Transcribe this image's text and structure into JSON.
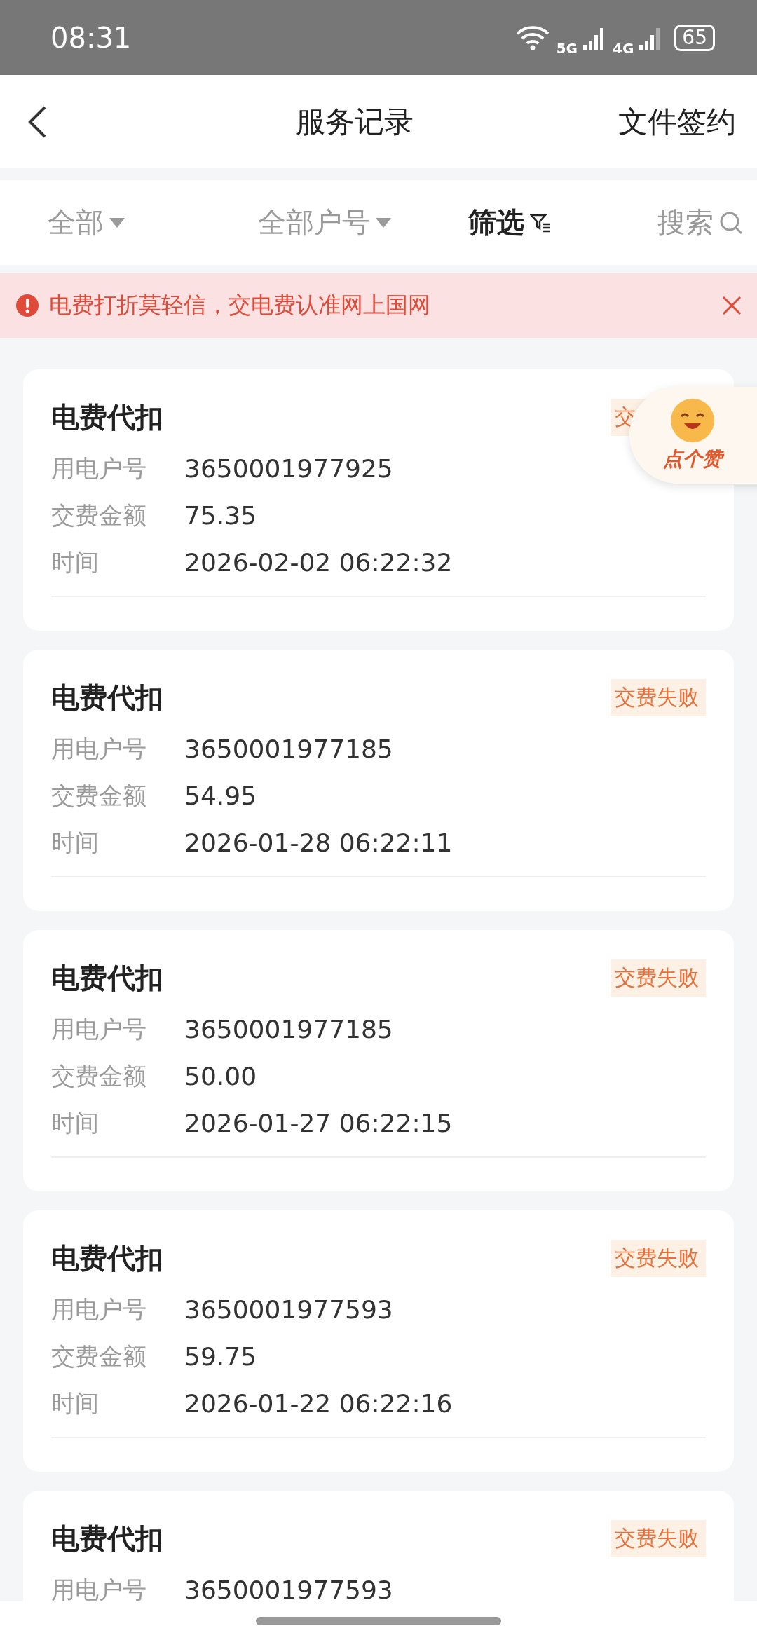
{
  "status_bar": {
    "time": "08:31",
    "network_1": "5G",
    "network_2": "4G",
    "battery": "65"
  },
  "header": {
    "title": "服务记录",
    "action": "文件签约"
  },
  "filters": [
    {
      "label": "全部",
      "kind": "dropdown",
      "selected": false
    },
    {
      "label": "全部户号",
      "kind": "dropdown",
      "selected": false
    },
    {
      "label": "筛选",
      "kind": "filter",
      "selected": true
    },
    {
      "label": "搜索",
      "kind": "search",
      "selected": false
    }
  ],
  "notice": {
    "text": "电费打折莫轻信，交电费认准网上国网"
  },
  "records": [
    {
      "title": "电费代扣",
      "status": "交",
      "fields": [
        {
          "label": "用电户号",
          "value": "3650001977925"
        },
        {
          "label": "交费金额",
          "value": "75.35"
        },
        {
          "label": "时间",
          "value": "2026-02-02 06:22:32"
        }
      ]
    },
    {
      "title": "电费代扣",
      "status": "交费失败",
      "fields": [
        {
          "label": "用电户号",
          "value": "3650001977185"
        },
        {
          "label": "交费金额",
          "value": "54.95"
        },
        {
          "label": "时间",
          "value": "2026-01-28 06:22:11"
        }
      ]
    },
    {
      "title": "电费代扣",
      "status": "交费失败",
      "fields": [
        {
          "label": "用电户号",
          "value": "3650001977185"
        },
        {
          "label": "交费金额",
          "value": "50.00"
        },
        {
          "label": "时间",
          "value": "2026-01-27 06:22:15"
        }
      ]
    },
    {
      "title": "电费代扣",
      "status": "交费失败",
      "fields": [
        {
          "label": "用电户号",
          "value": "3650001977593"
        },
        {
          "label": "交费金额",
          "value": "59.75"
        },
        {
          "label": "时间",
          "value": "2026-01-22 06:22:16"
        }
      ]
    },
    {
      "title": "电费代扣",
      "status": "交费失败",
      "fields": [
        {
          "label": "用电户号",
          "value": "3650001977593"
        }
      ]
    }
  ],
  "like_bubble": {
    "label": "点个赞"
  }
}
